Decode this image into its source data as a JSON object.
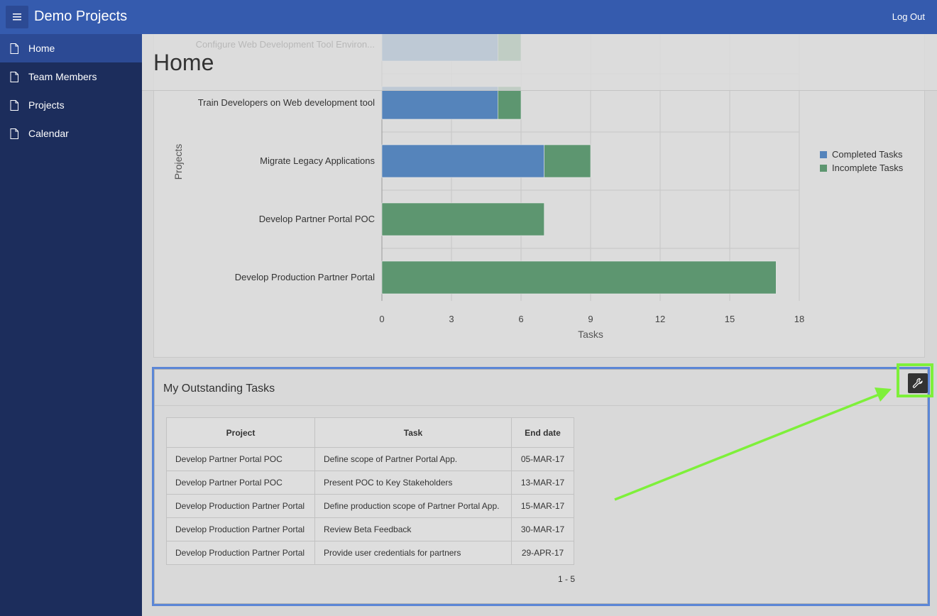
{
  "topbar": {
    "app_title": "Demo Projects",
    "logout_label": "Log Out",
    "menu_icon": "hamburger-icon"
  },
  "sidebar": {
    "items": [
      {
        "label": "Home",
        "active": true,
        "icon": "document-icon"
      },
      {
        "label": "Team Members",
        "active": false,
        "icon": "document-icon"
      },
      {
        "label": "Projects",
        "active": false,
        "icon": "document-icon"
      },
      {
        "label": "Calendar",
        "active": false,
        "icon": "document-icon"
      }
    ]
  },
  "page": {
    "title": "Home"
  },
  "chart_data": {
    "type": "bar",
    "orientation": "horizontal",
    "stacked": true,
    "categories": [
      "Configure Web Development Tool Environ...",
      "Train Developers on Web development tool",
      "Migrate Legacy Applications",
      "Develop Partner Portal POC",
      "Develop Production Partner Portal"
    ],
    "series": [
      {
        "name": "Completed Tasks",
        "color": "#5584bb",
        "values": [
          5,
          5,
          7,
          0,
          0
        ]
      },
      {
        "name": "Incomplete Tasks",
        "color": "#5d9670",
        "values": [
          1,
          1,
          2,
          7,
          17
        ]
      }
    ],
    "xlabel": "Tasks",
    "ylabel": "Projects",
    "xticks": [
      "0",
      "3",
      "6",
      "9",
      "12",
      "15",
      "18"
    ],
    "xlim": [
      0,
      18
    ],
    "grid": true,
    "legend": "right"
  },
  "tasks": {
    "title": "My Outstanding Tasks",
    "columns": [
      "Project",
      "Task",
      "End date"
    ],
    "rows": [
      [
        "Develop Partner Portal POC",
        "Define scope of Partner Portal App.",
        "05-MAR-17"
      ],
      [
        "Develop Partner Portal POC",
        "Present POC to Key Stakeholders",
        "13-MAR-17"
      ],
      [
        "Develop Production Partner Portal",
        "Define production scope of Partner Portal App.",
        "15-MAR-17"
      ],
      [
        "Develop Production Partner Portal",
        "Review Beta Feedback",
        "30-MAR-17"
      ],
      [
        "Develop Production Partner Portal",
        "Provide user credentials for partners",
        "29-APR-17"
      ]
    ],
    "pagination": "1 - 5",
    "actions_icon": "wrench-icon"
  },
  "colors": {
    "accent": "#355bae",
    "sidebar": "#1c2d5c",
    "annotation": "#7ef03a"
  }
}
